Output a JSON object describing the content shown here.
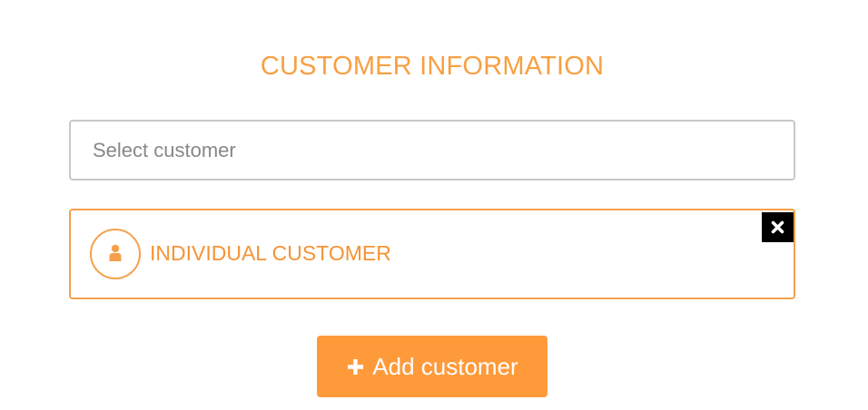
{
  "header": {
    "title": "CUSTOMER INFORMATION"
  },
  "customer_select": {
    "placeholder": "Select customer"
  },
  "customer_card": {
    "label": "INDIVIDUAL CUSTOMER",
    "avatar_icon": "person-icon",
    "remove_icon": "close-icon"
  },
  "actions": {
    "add_label": "Add customer",
    "add_icon": "plus-icon"
  },
  "colors": {
    "accent": "#f7a043",
    "button_bg": "#ff9a3a",
    "input_border": "#c8c8c8",
    "remove_bg": "#000000"
  }
}
